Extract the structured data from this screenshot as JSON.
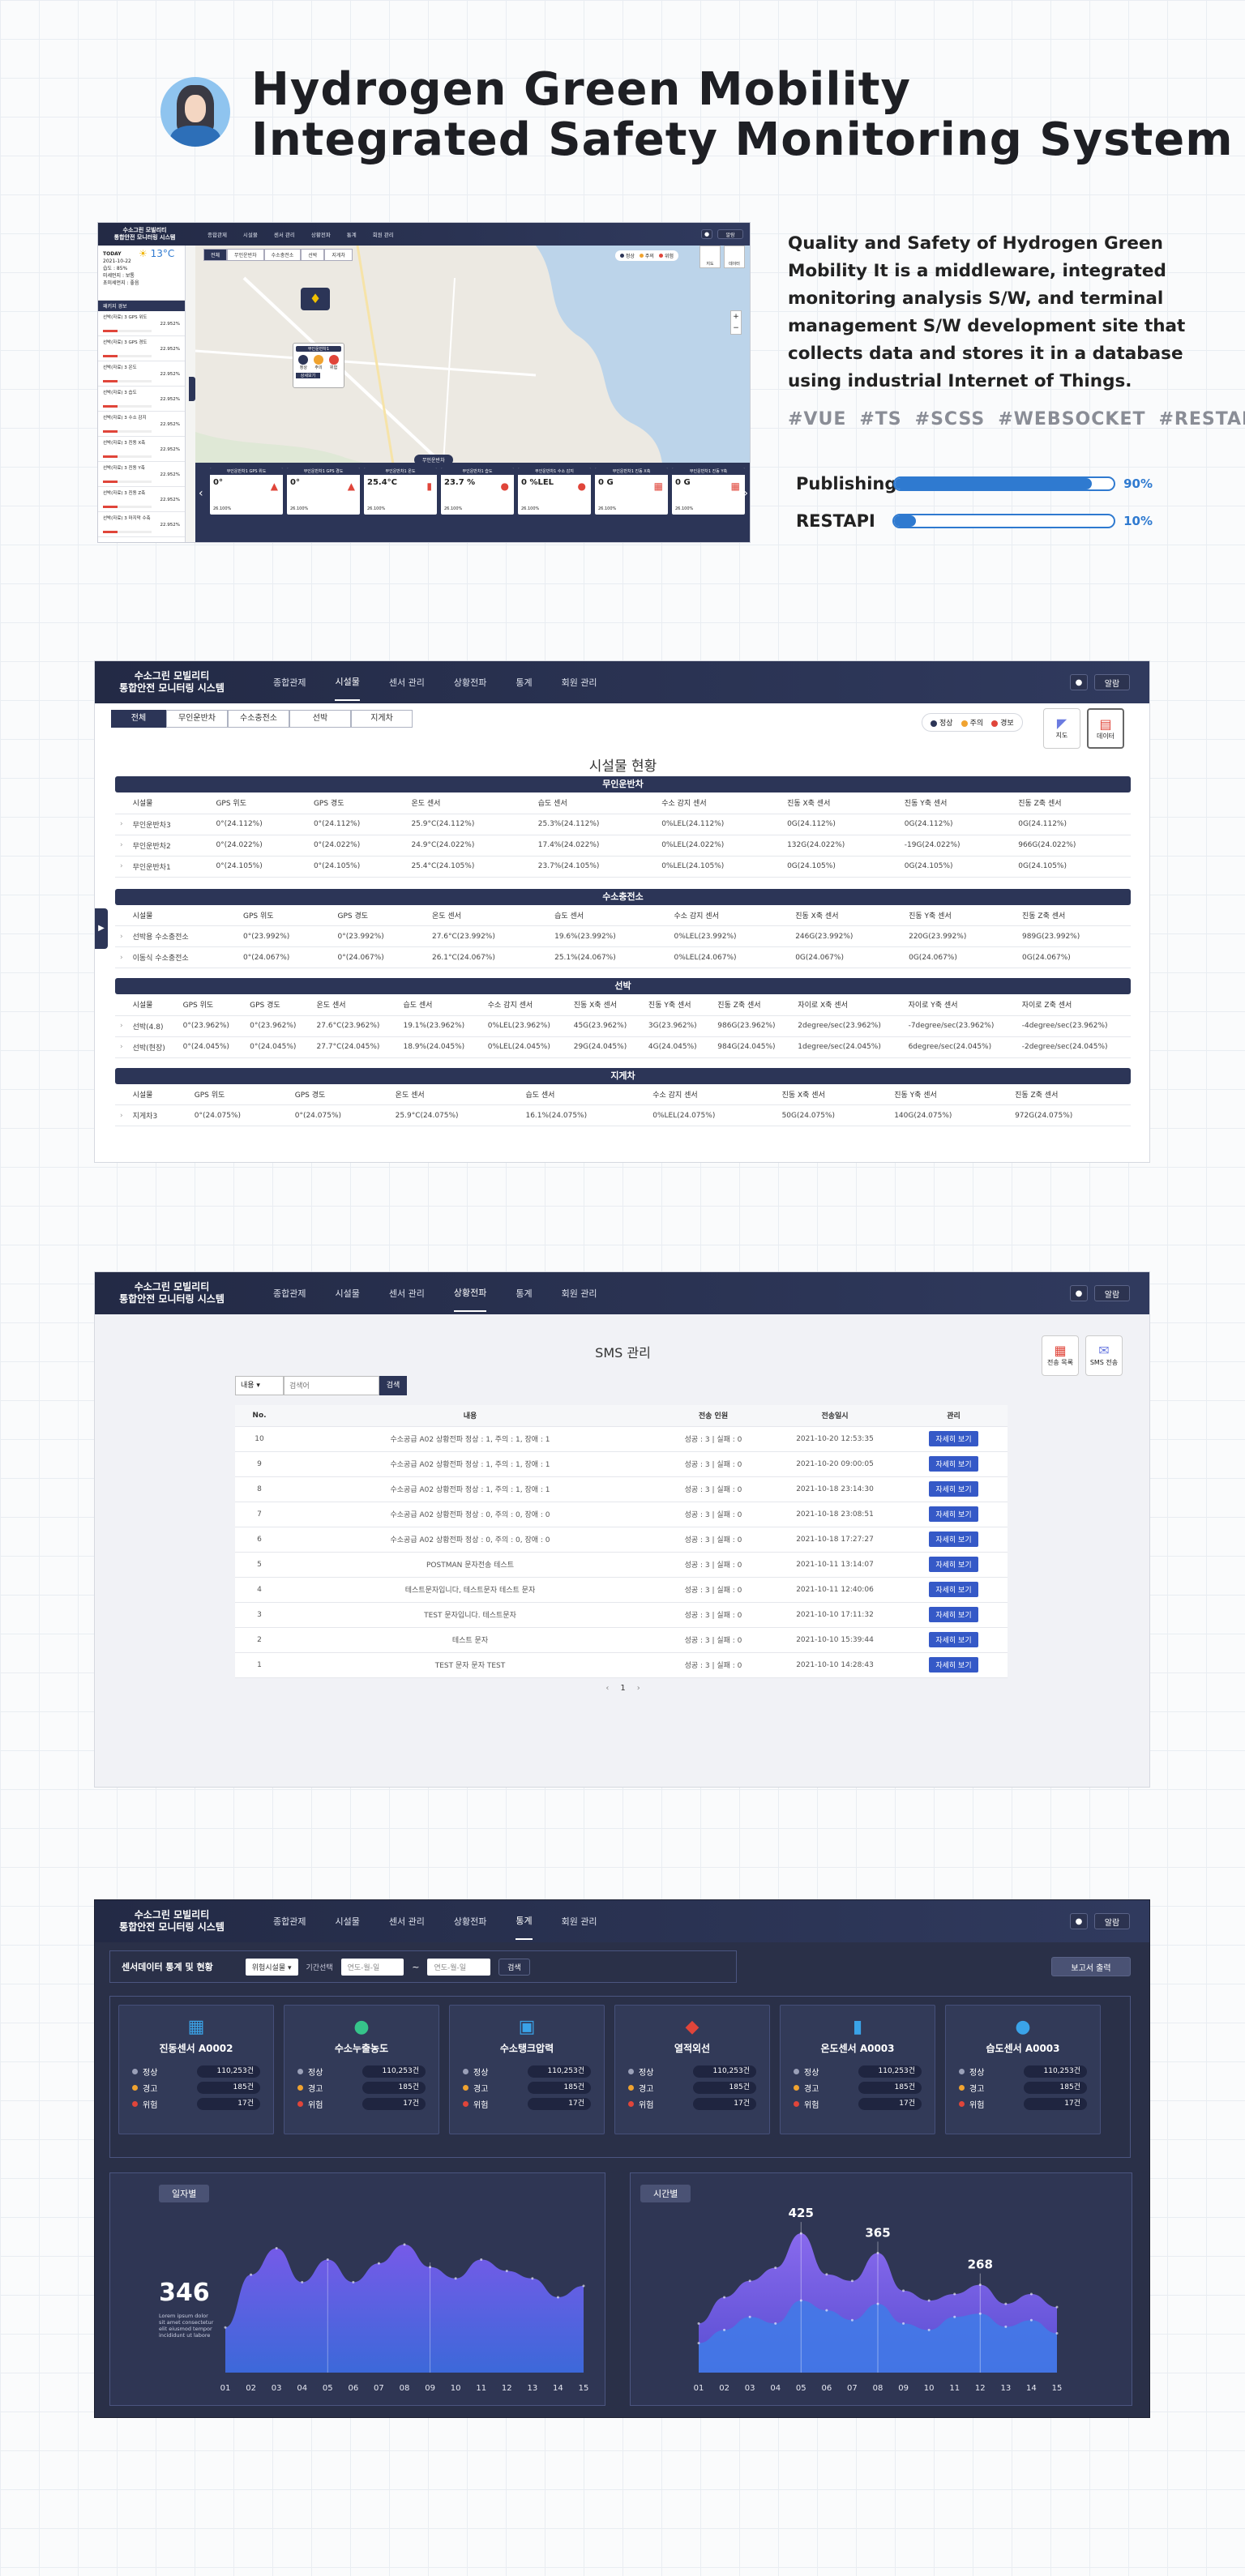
{
  "header": {
    "title_line1": "Hydrogen Green Mobility",
    "title_line2": "Integrated Safety Monitoring System"
  },
  "description": "Quality and Safety of Hydrogen Green Mobility It is a middleware, integrated monitoring analysis S/W, and terminal management S/W development site that collects data and stores it in a database using industrial Internet of Things.",
  "tags": [
    "#VUE",
    "#TS",
    "#SCSS",
    "#WEBSOCKET",
    "#RESTAPI"
  ],
  "skills": [
    {
      "label": "Publishing",
      "pct_text": "90%",
      "value": 0.9
    },
    {
      "label": "RESTAPI",
      "pct_text": "10%",
      "value": 0.1
    }
  ],
  "app": {
    "brand_line1": "수소그린 모빌리티",
    "brand_line2": "통합안전 모니터링 시스템",
    "menu": [
      "종합관제",
      "시설물",
      "센서 관리",
      "상황전파",
      "통계",
      "회원 관리"
    ],
    "alarm_label": "알람"
  },
  "colors": {
    "accent": "#2f7ad0",
    "navy": "#2c3557",
    "danger": "#e0453a",
    "warn": "#f0a330",
    "ok": "#2c3557"
  },
  "shot1": {
    "today": "TODAY",
    "date": "2021-10-22",
    "temp": "13°C",
    "weather_lines": [
      "습도 : 85%",
      "미세먼지 : 보통",
      "초미세먼지 : 좋음"
    ],
    "alert_title": "패키지 경보",
    "tabs": [
      "전체",
      "무인운반차",
      "수소충전소",
      "선박",
      "지게차"
    ],
    "legend": [
      "정상",
      "주의",
      "위험"
    ],
    "map_btns": [
      "지도",
      "데이터"
    ],
    "map_popup_title": "무인운반차1",
    "map_popup_badges": [
      "정상",
      "주의",
      "위험"
    ],
    "map_popup_link": "상세보기",
    "bottom_label": "무인운반차",
    "alerts": [
      {
        "name": "선박(자료) 3 GPS 위도",
        "val": "22.952%"
      },
      {
        "name": "선박(자료) 3 GPS 경도",
        "val": "22.952%"
      },
      {
        "name": "선박(자료) 3 온도",
        "val": "22.952%"
      },
      {
        "name": "선박(자료) 3 습도",
        "val": "22.952%"
      },
      {
        "name": "선박(자료) 3 수소 감지",
        "val": "22.952%"
      },
      {
        "name": "선박(자료) 3 진동 X축",
        "val": "22.952%"
      },
      {
        "name": "선박(자료) 3 진동 Y축",
        "val": "22.952%"
      },
      {
        "name": "선박(자료) 3 진동 Z축",
        "val": "22.952%"
      },
      {
        "name": "선박(자료) 3 마지막 수축",
        "val": "22.952%"
      }
    ],
    "bottom_cards": [
      {
        "title": "무인운반차1 GPS 위도",
        "value": "0°",
        "pct": "26.100%"
      },
      {
        "title": "무인운반차1 GPS 경도",
        "value": "0°",
        "pct": "26.100%"
      },
      {
        "title": "무인운반차1 온도",
        "value": "25.4°C",
        "pct": "26.100%"
      },
      {
        "title": "무인운반차1 습도",
        "value": "23.7 %",
        "pct": "26.100%"
      },
      {
        "title": "무인운반차1 수소 감지",
        "value": "0 %LEL",
        "pct": "26.100%"
      },
      {
        "title": "무인운반차1 진동 X축",
        "value": "0 G",
        "pct": "26.100%"
      },
      {
        "title": "무인운반차1 진동 Y축",
        "value": "0 G",
        "pct": "26.100%"
      }
    ]
  },
  "shot2": {
    "tabs": [
      "전체",
      "무인운반차",
      "수소충전소",
      "선박",
      "지게차"
    ],
    "legend": [
      "정상",
      "주의",
      "경보"
    ],
    "side_btns": [
      "지도",
      "데이터"
    ],
    "page_title": "시설물 현황",
    "sections": [
      {
        "title": "무인운반차",
        "headers": [
          "시설물",
          "GPS 위도",
          "GPS 경도",
          "온도 센서",
          "습도 센서",
          "수소 감지 센서",
          "진동 X축 센서",
          "진동 Y축 센서",
          "진동 Z축 센서"
        ],
        "rows": [
          [
            "무인운반차3",
            "0°(24.112%)",
            "0°(24.112%)",
            "25.9°C(24.112%)",
            "25.3%(24.112%)",
            "0%LEL(24.112%)",
            "0G(24.112%)",
            "0G(24.112%)",
            "0G(24.112%)"
          ],
          [
            "무인운반차2",
            "0°(24.022%)",
            "0°(24.022%)",
            "24.9°C(24.022%)",
            "17.4%(24.022%)",
            "0%LEL(24.022%)",
            "132G(24.022%)",
            "-19G(24.022%)",
            "966G(24.022%)"
          ],
          [
            "무인운반차1",
            "0°(24.105%)",
            "0°(24.105%)",
            "25.4°C(24.105%)",
            "23.7%(24.105%)",
            "0%LEL(24.105%)",
            "0G(24.105%)",
            "0G(24.105%)",
            "0G(24.105%)"
          ]
        ]
      },
      {
        "title": "수소충전소",
        "headers": [
          "시설물",
          "GPS 위도",
          "GPS 경도",
          "온도 센서",
          "습도 센서",
          "수소 감지 센서",
          "진동 X축 센서",
          "진동 Y축 센서",
          "진동 Z축 센서"
        ],
        "rows": [
          [
            "선박용 수소충전소",
            "0°(23.992%)",
            "0°(23.992%)",
            "27.6°C(23.992%)",
            "19.6%(23.992%)",
            "0%LEL(23.992%)",
            "246G(23.992%)",
            "220G(23.992%)",
            "989G(23.992%)"
          ],
          [
            "이동식 수소충전소",
            "0°(24.067%)",
            "0°(24.067%)",
            "26.1°C(24.067%)",
            "25.1%(24.067%)",
            "0%LEL(24.067%)",
            "0G(24.067%)",
            "0G(24.067%)",
            "0G(24.067%)"
          ]
        ]
      },
      {
        "title": "선박",
        "headers": [
          "시설물",
          "GPS 위도",
          "GPS 경도",
          "온도 센서",
          "습도 센서",
          "수소 감지 센서",
          "진동 X축 센서",
          "진동 Y축 센서",
          "진동 Z축 센서",
          "자이로 X축 센서",
          "자이로 Y축 센서",
          "자이로 Z축 센서"
        ],
        "rows": [
          [
            "선박(4.8)",
            "0°(23.962%)",
            "0°(23.962%)",
            "27.6°C(23.962%)",
            "19.1%(23.962%)",
            "0%LEL(23.962%)",
            "45G(23.962%)",
            "3G(23.962%)",
            "986G(23.962%)",
            "2degree/sec(23.962%)",
            "-7degree/sec(23.962%)",
            "-4degree/sec(23.962%)"
          ],
          [
            "선박(현장)",
            "0°(24.045%)",
            "0°(24.045%)",
            "27.7°C(24.045%)",
            "18.9%(24.045%)",
            "0%LEL(24.045%)",
            "29G(24.045%)",
            "4G(24.045%)",
            "984G(24.045%)",
            "1degree/sec(24.045%)",
            "6degree/sec(24.045%)",
            "-2degree/sec(24.045%)"
          ]
        ]
      },
      {
        "title": "지게차",
        "headers": [
          "시설물",
          "GPS 위도",
          "GPS 경도",
          "온도 센서",
          "습도 센서",
          "수소 감지 센서",
          "진동 X축 센서",
          "진동 Y축 센서",
          "진동 Z축 센서"
        ],
        "rows": [
          [
            "지게차3",
            "0°(24.075%)",
            "0°(24.075%)",
            "25.9°C(24.075%)",
            "16.1%(24.075%)",
            "0%LEL(24.075%)",
            "50G(24.075%)",
            "140G(24.075%)",
            "972G(24.075%)"
          ]
        ]
      }
    ]
  },
  "shot3": {
    "page_title": "SMS 관리",
    "side_btns": [
      "전송 목록",
      "SMS 전송"
    ],
    "search_select": "내용",
    "search_placeholder": "검색어",
    "search_button": "검색",
    "headers": [
      "No.",
      "내용",
      "전송 인원",
      "전송일시",
      "관리"
    ],
    "detail_label": "자세히 보기",
    "pagination": [
      "‹",
      "1",
      "›"
    ],
    "rows": [
      {
        "no": "10",
        "content": "수소공급 A02 상황전파 정상 : 1, 주의 : 1, 장애 : 1",
        "sent": "성공 : 3 | 실패 : 0",
        "date": "2021-10-20 12:53:35"
      },
      {
        "no": "9",
        "content": "수소공급 A02 상황전파 정상 : 1, 주의 : 1, 장애 : 1",
        "sent": "성공 : 3 | 실패 : 0",
        "date": "2021-10-20 09:00:05"
      },
      {
        "no": "8",
        "content": "수소공급 A02 상황전파 정상 : 1, 주의 : 1, 장애 : 1",
        "sent": "성공 : 3 | 실패 : 0",
        "date": "2021-10-18 23:14:30"
      },
      {
        "no": "7",
        "content": "수소공급 A02 상황전파 정상 : 0, 주의 : 0, 장애 : 0",
        "sent": "성공 : 3 | 실패 : 0",
        "date": "2021-10-18 23:08:51"
      },
      {
        "no": "6",
        "content": "수소공급 A02 상황전파 정상 : 0, 주의 : 0, 장애 : 0",
        "sent": "성공 : 3 | 실패 : 0",
        "date": "2021-10-18 17:27:27"
      },
      {
        "no": "5",
        "content": "POSTMAN 문자전송 테스트",
        "sent": "성공 : 3 | 실패 : 0",
        "date": "2021-10-11 13:14:07"
      },
      {
        "no": "4",
        "content": "테스트문자입니다, 테스트문자 테스트 문자",
        "sent": "성공 : 3 | 실패 : 0",
        "date": "2021-10-11 12:40:06"
      },
      {
        "no": "3",
        "content": "TEST 문자입니다. 테스트문자",
        "sent": "성공 : 3 | 실패 : 0",
        "date": "2021-10-10 17:11:32"
      },
      {
        "no": "2",
        "content": "테스트 문자",
        "sent": "성공 : 3 | 실패 : 0",
        "date": "2021-10-10 15:39:44"
      },
      {
        "no": "1",
        "content": "TEST 문자 문자 TEST",
        "sent": "성공 : 3 | 실패 : 0",
        "date": "2021-10-10 14:28:43"
      }
    ]
  },
  "shot4": {
    "filter_title": "센서데이터 통계 및 현황",
    "select_value": "위험시설물",
    "period_label": "기간선택",
    "date_placeholder": "연도-월-일",
    "search_button": "검색",
    "report_button": "보고서 출력",
    "status_labels": [
      "정상",
      "경고",
      "위험"
    ],
    "cards": [
      {
        "title": "진동센서 A0002",
        "icon": "grid-icon",
        "values": [
          "110,253건",
          "185건",
          "17건"
        ]
      },
      {
        "title": "수소누출농도",
        "icon": "drop-icon",
        "values": [
          "110,253건",
          "185건",
          "17건"
        ]
      },
      {
        "title": "수소탱크압력",
        "icon": "tank-icon",
        "values": [
          "110,253건",
          "185건",
          "17건"
        ]
      },
      {
        "title": "열적외선",
        "icon": "heat-icon",
        "values": [
          "110,253건",
          "185건",
          "17건"
        ]
      },
      {
        "title": "온도센서 A0003",
        "icon": "thermometer-icon",
        "values": [
          "110,253건",
          "185건",
          "17건"
        ]
      },
      {
        "title": "습도센서 A0003",
        "icon": "humidity-icon",
        "values": [
          "110,253건",
          "185건",
          "17건"
        ]
      }
    ],
    "daily_tag": "일자별",
    "daily_value": "346",
    "daily_note": "Lorem ipsum dolor sit amet consectetur elit eiusmod tempor incididunt ut labore",
    "hourly_tag": "시간별",
    "hourly_peaks": [
      {
        "value": "425",
        "x": "05"
      },
      {
        "value": "365",
        "x": "08"
      },
      {
        "value": "268",
        "x": "12"
      }
    ],
    "x_ticks": [
      "01",
      "02",
      "03",
      "04",
      "05",
      "06",
      "07",
      "08",
      "09",
      "10",
      "11",
      "12",
      "13",
      "14",
      "15"
    ]
  },
  "chart_data": [
    {
      "type": "area",
      "title": "일자별",
      "x": [
        "01",
        "02",
        "03",
        "04",
        "05",
        "06",
        "07",
        "08",
        "09",
        "10",
        "11",
        "12",
        "13",
        "14",
        "15"
      ],
      "series": [
        {
          "values": [
            120,
            260,
            330,
            240,
            300,
            240,
            290,
            340,
            280,
            250,
            300,
            270,
            250,
            200,
            230
          ]
        }
      ]
    },
    {
      "type": "area",
      "title": "시간별",
      "x": [
        "01",
        "02",
        "03",
        "04",
        "05",
        "06",
        "07",
        "08",
        "09",
        "10",
        "11",
        "12",
        "13",
        "14",
        "15"
      ],
      "series": [
        {
          "values": [
            150,
            230,
            280,
            320,
            425,
            300,
            280,
            365,
            250,
            220,
            240,
            268,
            210,
            240,
            200
          ]
        },
        {
          "values": [
            90,
            130,
            170,
            150,
            220,
            190,
            160,
            210,
            150,
            130,
            170,
            180,
            140,
            160,
            120
          ]
        }
      ]
    }
  ]
}
